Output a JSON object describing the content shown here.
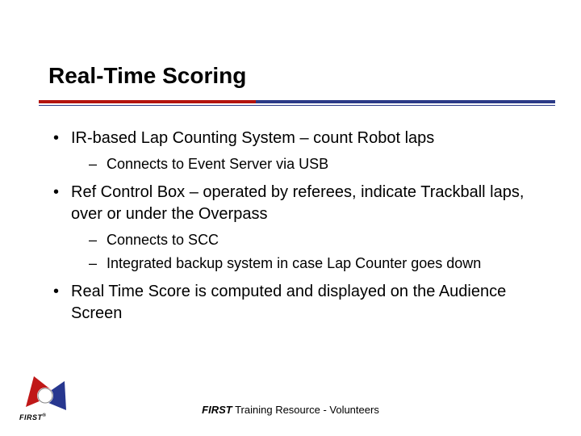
{
  "title": "Real-Time Scoring",
  "bullets": [
    {
      "text": "IR-based Lap Counting System – count Robot laps",
      "sub": [
        "Connects to Event Server via USB"
      ]
    },
    {
      "text": "Ref Control Box – operated by referees, indicate Trackball laps, over or under the Overpass",
      "sub": [
        "Connects to SCC",
        "Integrated backup system in case Lap Counter goes down"
      ]
    },
    {
      "text": "Real Time Score is computed and displayed on the Audience Screen",
      "sub": []
    }
  ],
  "footer": {
    "brand": "FIRST",
    "rest": " Training Resource - Volunteers"
  },
  "logo": {
    "text": "FIRST",
    "reg": "®"
  }
}
